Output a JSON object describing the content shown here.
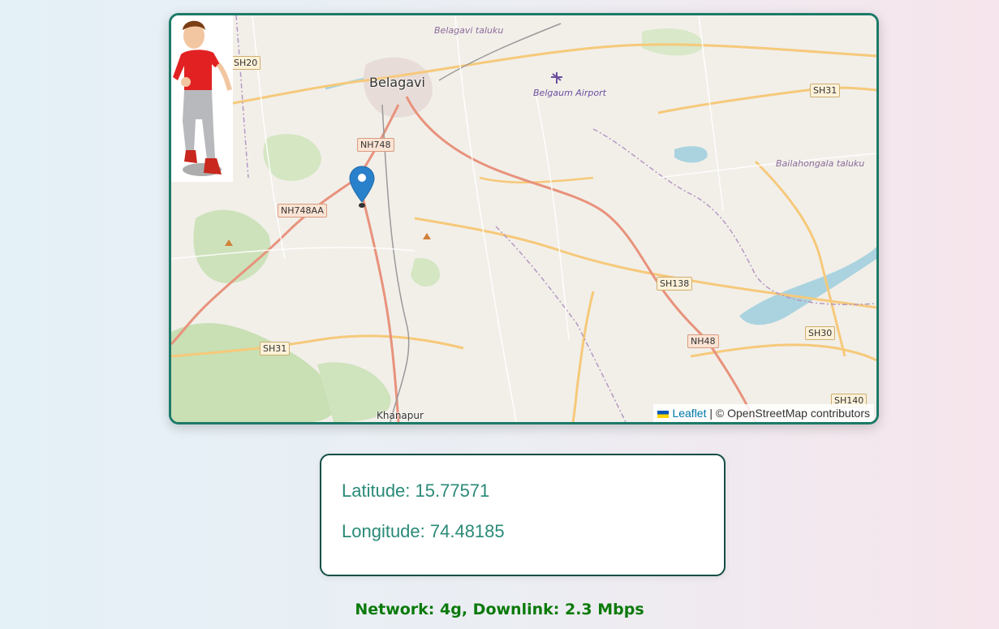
{
  "map": {
    "place_labels": {
      "belagavi": "Belagavi",
      "belagavi_taluku": "Belagavi taluku",
      "belgaum_airport": "Belgaum Airport",
      "bailahongala_taluku": "Bailahongala taluku",
      "khanapur": "Khanapur"
    },
    "road_shields": {
      "sh20": "SH20",
      "nh748": "NH748",
      "nh748aa": "NH748AA",
      "sh31_north": "SH31",
      "sh31_south": "SH31",
      "sh138": "SH138",
      "nh48": "NH48",
      "sh30": "SH30",
      "sh140": "SH140"
    },
    "attribution": {
      "leaflet": "Leaflet",
      "rest": "| © OpenStreetMap contributors"
    },
    "marker_icon": "map-pin-icon",
    "colors": {
      "border": "#1c7a68",
      "marker": "#2a81cb",
      "trunk_road": "#e8927c",
      "secondary_road": "#f6c97a"
    }
  },
  "location": {
    "latitude_text": "Latitude: 15.77571",
    "longitude_text": "Longitude: 74.48185"
  },
  "network": {
    "status_text": "Network: 4g, Downlink: 2.3 Mbps"
  }
}
